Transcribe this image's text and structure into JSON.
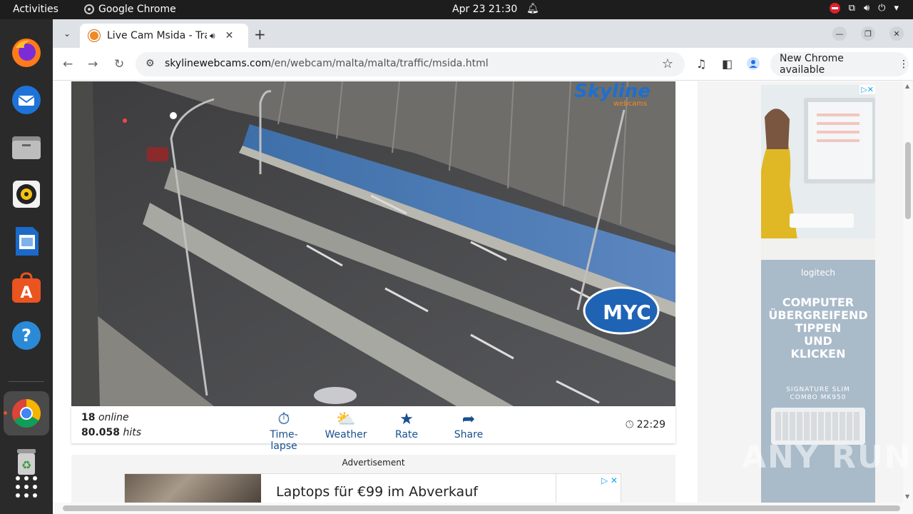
{
  "system": {
    "activities": "Activities",
    "app_name": "Google Chrome",
    "datetime": "Apr 23  21:30"
  },
  "browser": {
    "tab_title": "Live Cam Msida - Traffic",
    "new_tab": "+",
    "url_domain": "skylinewebcams.com",
    "url_path": "/en/webcam/malta/malta/traffic/msida.html",
    "update_label": "New Chrome available"
  },
  "webcam": {
    "brand_top": "Skyline",
    "brand_bottom": "webcams",
    "overlay_logo": "MYC",
    "online_count": "18",
    "online_label": "online",
    "hits_count": "80.058",
    "hits_label": "hits",
    "actions": [
      "Time-lapse",
      "Weather",
      "Rate",
      "Share"
    ],
    "time": "22:29"
  },
  "ads": {
    "label": "Advertisement",
    "bottom_text": "Laptops für €99 im Abverkauf",
    "side_brand": "logitech",
    "side_headline": [
      "COMPUTER",
      "ÜBERGREIFEND",
      "TIPPEN",
      "UND",
      "KLICKEN"
    ],
    "side_product_1": "SIGNATURE SLIM",
    "side_product_2": "COMBO MK950"
  },
  "watermark": "ANY RUN"
}
